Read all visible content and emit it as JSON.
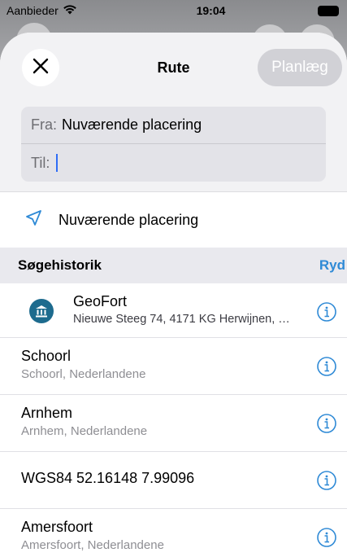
{
  "status_bar": {
    "carrier": "Aanbieder",
    "time": "19:04"
  },
  "header": {
    "close_icon": "close-icon",
    "title": "Rute",
    "plan_button": "Planlæg"
  },
  "route": {
    "from_label": "Fra:",
    "from_value": "Nuværende placering",
    "to_label": "Til:",
    "to_value": ""
  },
  "current_location": {
    "icon": "location-arrow-icon",
    "label": "Nuværende placering"
  },
  "history": {
    "title": "Søgehistorik",
    "clear_label": "Ryd",
    "items": [
      {
        "title": "GeoFort",
        "subtitle": "Nieuwe Steeg 74, 4171 KG Herwijnen, Ne...",
        "icon": "museum-icon"
      },
      {
        "title": "Schoorl",
        "subtitle": "Schoorl, Nederlandene"
      },
      {
        "title": "Arnhem",
        "subtitle": "Arnhem, Nederlandene"
      },
      {
        "title": "WGS84 52.16148 7.99096",
        "subtitle": ""
      },
      {
        "title": "Amersfoort",
        "subtitle": "Amersfoort, Nederlandene"
      }
    ]
  },
  "colors": {
    "accent": "#2f8ad6",
    "caret": "#2f6df6",
    "plan_button_disabled": "#d1d1d6",
    "poi_icon_bg": "#1d6b8e"
  }
}
